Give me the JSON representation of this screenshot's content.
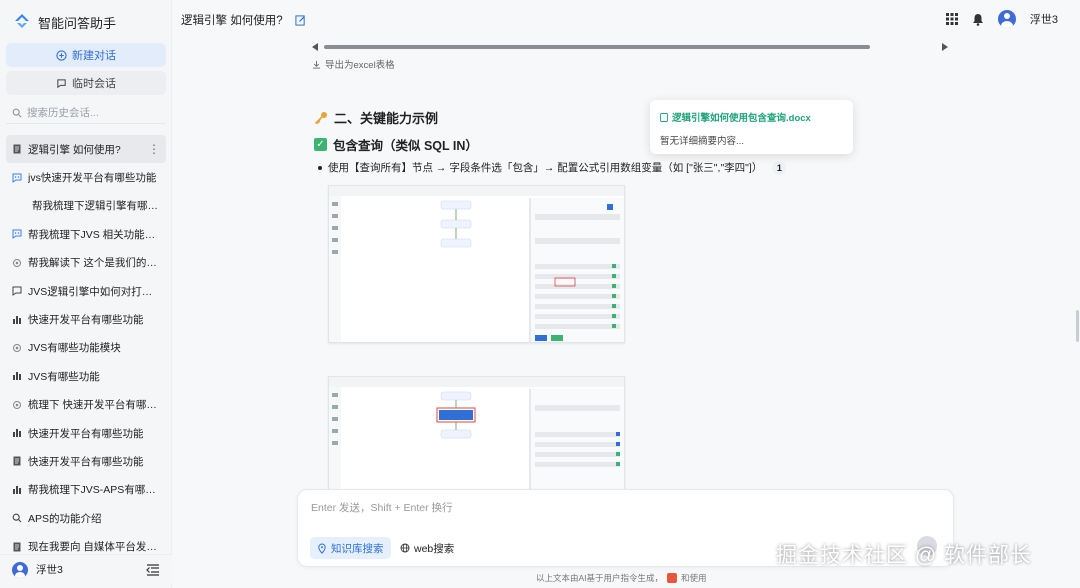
{
  "app": {
    "title": "智能问答助手"
  },
  "sidebar": {
    "new_chat": "新建对话",
    "temp_chat": "临时会话",
    "search_placeholder": "搜索历史会话...",
    "items": [
      {
        "label": "逻辑引擎 如何使用?",
        "icon": "document-icon",
        "active": true
      },
      {
        "label": "jvs快速开发平台有哪些功能",
        "icon": "chat-bot-icon"
      },
      {
        "label": "帮我梳理下逻辑引擎有哪些...",
        "icon": "none"
      },
      {
        "label": "帮我梳理下JVS 相关功能模块",
        "icon": "chat-bot-icon"
      },
      {
        "label": "帮我解读下 这个是我们的一...",
        "icon": "gear-icon"
      },
      {
        "label": "JVS逻辑引擎中如何对打打...",
        "icon": "chat-icon"
      },
      {
        "label": "快速开发平台有哪些功能",
        "icon": "bar-chart-icon"
      },
      {
        "label": "JVS有哪些功能模块",
        "icon": "gear-icon"
      },
      {
        "label": "JVS有哪些功能",
        "icon": "bar-chart-icon"
      },
      {
        "label": "梳理下 快速开发平台有哪些...",
        "icon": "gear-icon"
      },
      {
        "label": "快速开发平台有哪些功能",
        "icon": "bar-chart-icon"
      },
      {
        "label": "快速开发平台有哪些功能",
        "icon": "document-icon"
      },
      {
        "label": "帮我梳理下JVS-APS有哪些...",
        "icon": "bar-chart-icon"
      },
      {
        "label": "APS的功能介绍",
        "icon": "search-icon"
      },
      {
        "label": "现在我要向 自媒体平台发送...",
        "icon": "document-icon"
      }
    ],
    "user": "浮世3"
  },
  "header": {
    "chat_title": "逻辑引擎 如何使用?",
    "user": "浮世3"
  },
  "content": {
    "export_label": "导出为excel表格",
    "section_title": "二、关键能力示例",
    "subsection_title": "包含查询（类似 SQL IN）",
    "bullet_text": "使用【查询所有】节点 → 字段条件选「包含」→ 配置公式引用数组变量（如 [\"张三\",\"李四\"]）",
    "citation": "1"
  },
  "tooltip": {
    "title": "逻辑引擎如何使用包含查询.docx",
    "body": "暂无详细摘要内容..."
  },
  "input": {
    "placeholder": "Enter 发送，Shift + Enter 换行",
    "kb_search": "知识库搜索",
    "web_search": "web搜索"
  },
  "footer": {
    "note_left": "以上文本由AI基于用户指令生成，",
    "note_right": "和使用"
  },
  "watermark": "掘金技术社区 @ 软件部长",
  "colors": {
    "accent": "#2f6fd6",
    "green": "#20a37a",
    "sidebar_bg": "#f5f6f8"
  }
}
